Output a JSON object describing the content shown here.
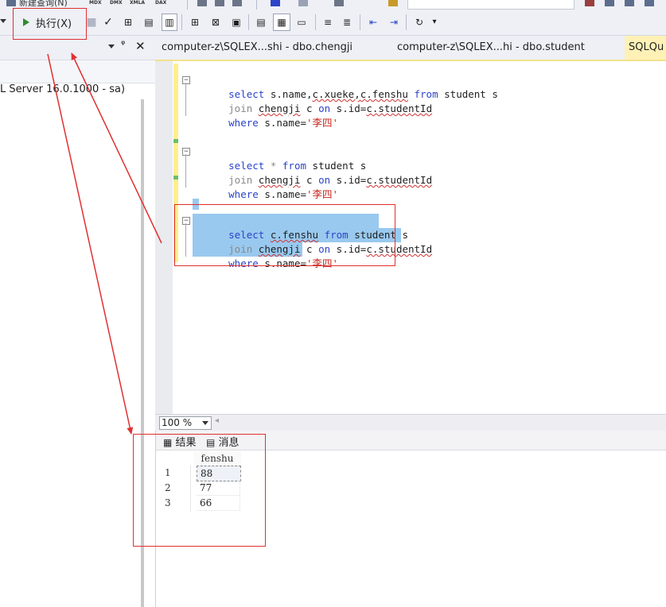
{
  "toolbar_top": {
    "new_query_label": "新建查询(N)",
    "mini_labels": [
      "MDX",
      "DMX",
      "XMLA",
      "DAX"
    ]
  },
  "toolbar": {
    "execute_label": "执行(X)"
  },
  "left_pane": {
    "server_text": "L Server 16.0.1000 - sa)"
  },
  "tabs": [
    {
      "label": "computer-z\\SQLEX...shi - dbo.chengji"
    },
    {
      "label": "computer-z\\SQLEX...hi - dbo.student"
    },
    {
      "label": "SQLQu"
    }
  ],
  "editor": {
    "block1": {
      "line1_kw1": "select",
      "line1_a": "s.name,",
      "line1_b": "c.xueke,",
      "line1_c": "c.fenshu",
      "line1_kw2": "from",
      "line1_tail": "student s",
      "line2_join": "join",
      "line2_tbl": "chengji",
      "line2_mid": "c",
      "line2_on": "on",
      "line2_eq": "s.id=",
      "line2_col": "c.studentId",
      "line3_kw": "where",
      "line3_mid": "s.name=",
      "line3_str": "'李四'"
    },
    "block2": {
      "line1_kw1": "select",
      "line1_star": "*",
      "line1_kw2": "from",
      "line1_tail": "student s",
      "line2_join": "join",
      "line2_tbl": "chengji",
      "line2_mid": "c",
      "line2_on": "on",
      "line2_eq": "s.id=",
      "line2_col": "c.studentId",
      "line3_kw": "where",
      "line3_mid": "s.name=",
      "line3_str": "'李四'"
    },
    "block3": {
      "line1_kw1": "select",
      "line1_col": "c.fenshu",
      "line1_kw2": "from",
      "line1_tail": "student s",
      "line2_join": "join",
      "line2_tbl": "chengji",
      "line2_mid": "c",
      "line2_on": "on",
      "line2_eq": "s.id=",
      "line2_col": "c.studentId",
      "line3_kw": "where",
      "line3_mid": "s.name=",
      "line3_str": "'李四'"
    }
  },
  "zoom": {
    "value": "100 %"
  },
  "results": {
    "tab_results": "结果",
    "tab_messages": "消息",
    "column": "fenshu",
    "rows": [
      {
        "num": "1",
        "value": "88"
      },
      {
        "num": "2",
        "value": "77"
      },
      {
        "num": "3",
        "value": "66"
      }
    ]
  },
  "colors": {
    "annotation_red": "#e03030",
    "selection": "#99c9ef",
    "keyword": "#2b44c9",
    "string": "#c8281e",
    "active_tab": "#fff1b6"
  }
}
